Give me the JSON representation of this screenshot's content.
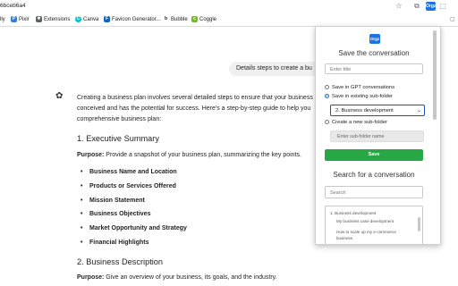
{
  "browser": {
    "url_fragment": "6bceb6a4",
    "extension_badge": "Orgz",
    "bookmarks": [
      {
        "label": "lly",
        "color": "#ffffff"
      },
      {
        "label": "Pixlr",
        "color": "#3b7ddd"
      },
      {
        "label": "Extensions",
        "color": "#5f6368"
      },
      {
        "label": "Canva",
        "color": "#00c4cc"
      },
      {
        "label": "Favicon Generator...",
        "color": "#1565c0"
      },
      {
        "label": "Bubble",
        "color": "#222222"
      },
      {
        "label": "Coggle",
        "color": "#7cb342"
      }
    ]
  },
  "chat": {
    "user_message": "Details steps to create a bu",
    "intro": "Creating a business plan involves several detailed steps to ensure that your business conceived and has the potential for success. Here's a step-by-step guide to help you comprehensive business plan:",
    "intro_lines": [
      "Creating a business plan involves several detailed steps to ensure that your business",
      "conceived and has the potential for success. Here's a step-by-step guide to help you",
      "comprehensive business plan:"
    ],
    "section1": {
      "heading": "1. Executive Summary",
      "purpose_label": "Purpose:",
      "purpose_text": " Provide a snapshot of your business plan, summarizing the key points.",
      "bullets": [
        "Business Name and Location",
        "Products or Services Offered",
        "Mission Statement",
        "Business Objectives",
        "Market Opportunity and Strategy",
        "Financial Highlights"
      ]
    },
    "section2": {
      "heading": "2. Business Description",
      "purpose_label": "Purpose:",
      "purpose_text": " Give an overview of your business, its goals, and the industry."
    }
  },
  "popup": {
    "logo": "Orgz",
    "title": "Save the conversation",
    "title_input_placeholder": "Enter title",
    "radio_gpt": "Save in GPT conversations",
    "radio_existing": "Save in existing sub-folder",
    "selected_folder": "2. Business development",
    "radio_new": "Create a new sub-folder",
    "subfolder_placeholder": "Enter sub-folder name",
    "save_label": "Save",
    "search_title": "Search for a conversation",
    "search_placeholder": "Search",
    "list": {
      "folder": "1. Business development",
      "items": [
        "My business case development",
        "How to scale up my e-commerce",
        "business"
      ]
    }
  }
}
